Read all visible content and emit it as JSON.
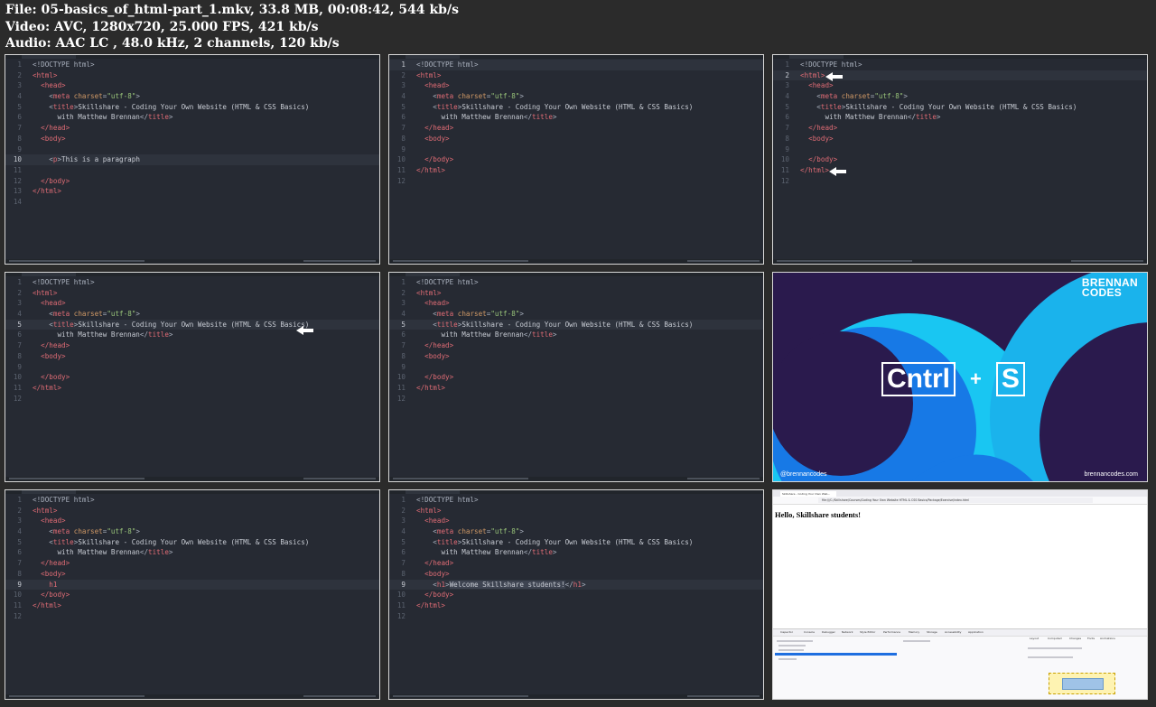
{
  "header": {
    "file_line": "File: 05-basics_of_html-part_1.mkv, 33.8 MB, 00:08:42, 544 kb/s",
    "video_line": "Video: AVC, 1280x720, 25.000 FPS, 421 kb/s",
    "audio_line": "Audio: AAC LC , 48.0 kHz, 2 channels, 120 kb/s"
  },
  "code": {
    "doctype": "<!DOCTYPE html>",
    "html_open": "<html>",
    "html_close": "</html>",
    "head_open": "<head>",
    "head_close": "</head>",
    "body_open": "<body>",
    "body_close": "</body>",
    "meta_tag": "meta",
    "meta_attr": "charset",
    "meta_value": "\"utf-8\"",
    "title_tag": "title",
    "title_text_1": "Skillshare - Coding Your Own Website (HTML & CSS Basics)",
    "title_text_2": "with Matthew Brennan",
    "p_tag": "p",
    "p_text": "This is a paragraph",
    "h1_tag": "h1",
    "h1_text": "Welcome Skillshare students!"
  },
  "slide": {
    "logo_line1": "BRENNAN",
    "logo_line2": "CODES",
    "key1": "Cntrl",
    "plus": "+",
    "key2": "S",
    "handle": "@brennancodes",
    "website": "brennancodes.com",
    "colors": {
      "bg": "#2a1a4d",
      "cyan": "#19c6f2",
      "blue": "#1779e6"
    }
  },
  "browser": {
    "tab_title": "Skillshare - Coding Your Own Web...",
    "url": "file:///C:/Skillshare/Courses/Coding Your Own Website HTML & CSS Basics/Package/Exercise/index.html",
    "page_heading": "Hello, Skillshare students!",
    "devtools_tabs": [
      "Inspector",
      "Console",
      "Debugger",
      "Network",
      "Style Editor",
      "Performance",
      "Memory",
      "Storage",
      "Accessibility",
      "Application"
    ],
    "side_tabs": [
      "Layout",
      "Computed",
      "Changes",
      "Fonts",
      "Animations"
    ]
  }
}
